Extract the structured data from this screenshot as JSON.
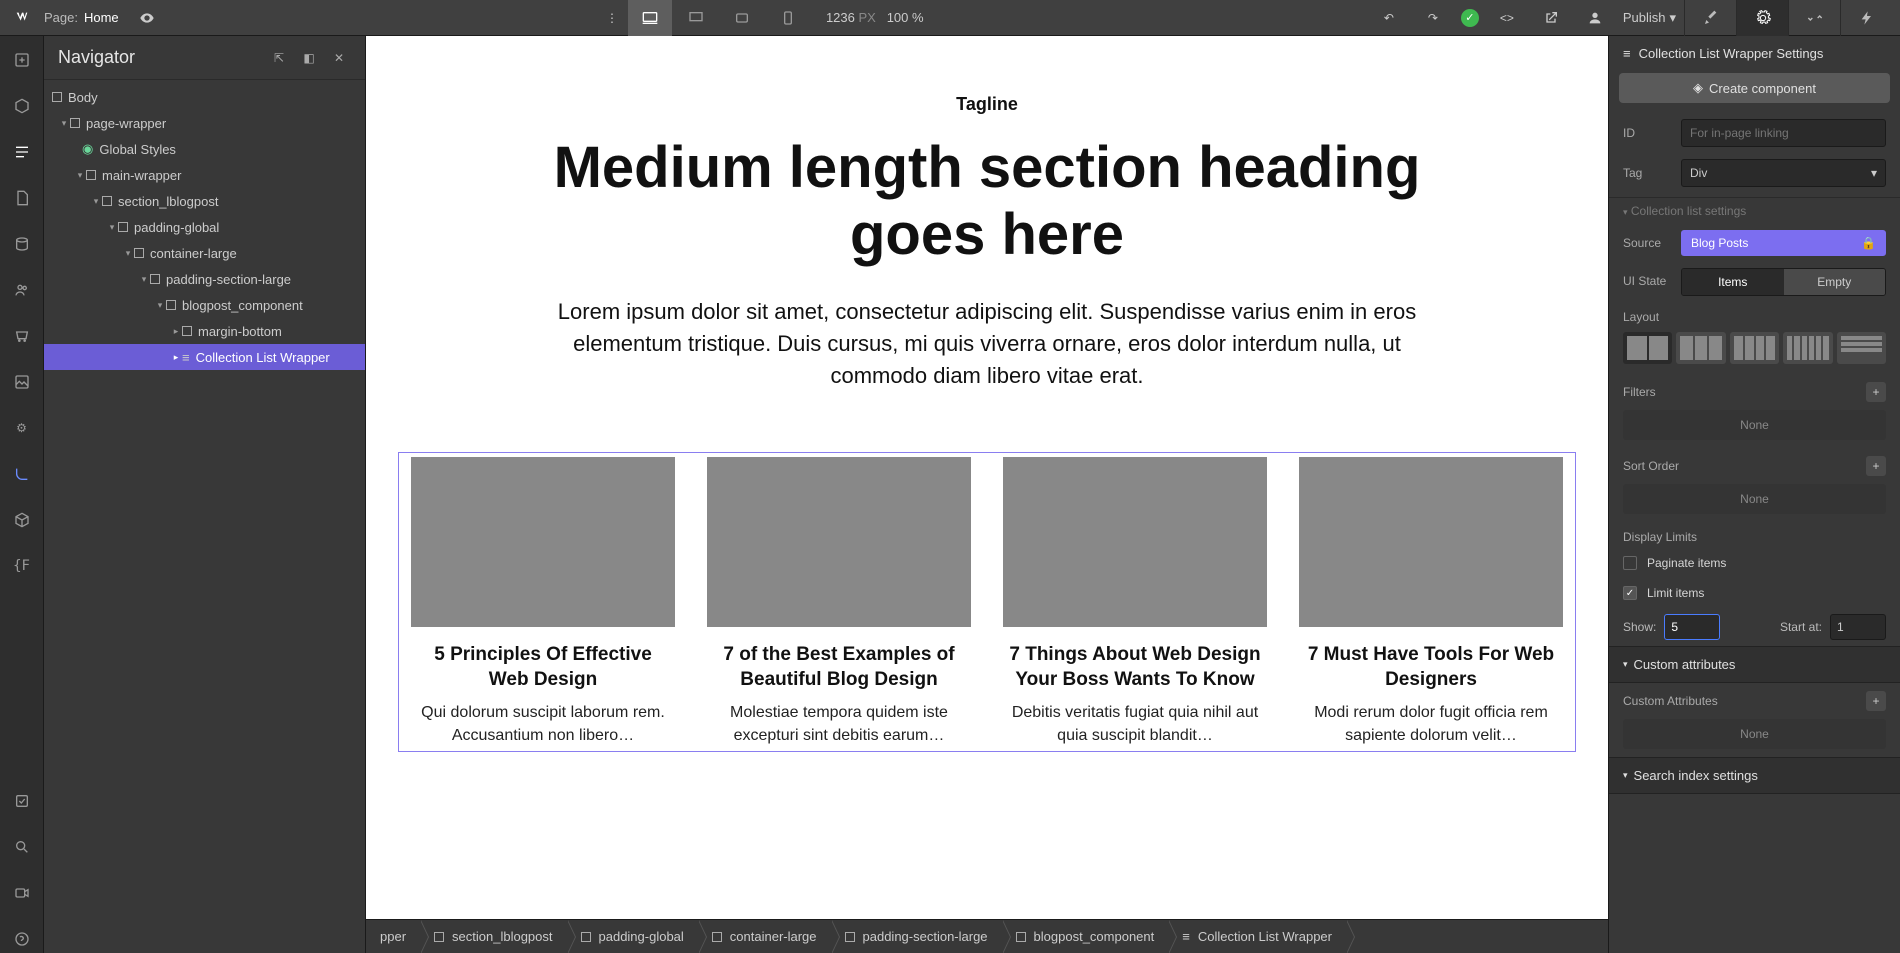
{
  "topbar": {
    "page_label": "Page:",
    "page_name": "Home",
    "canvas_width": "1236",
    "px_label": "PX",
    "zoom": "100 %",
    "publish": "Publish"
  },
  "navigator": {
    "title": "Navigator",
    "tree": {
      "body": "Body",
      "page_wrapper": "page-wrapper",
      "global_styles": "Global Styles",
      "main_wrapper": "main-wrapper",
      "section": "section_lblogpost",
      "padding_global": "padding-global",
      "container": "container-large",
      "padding_section": "padding-section-large",
      "component": "blogpost_component",
      "margin_bottom": "margin-bottom",
      "collection": "Collection List Wrapper"
    }
  },
  "content": {
    "tagline": "Tagline",
    "heading": "Medium length section heading goes here",
    "lead": "Lorem ipsum dolor sit amet, consectetur adipiscing elit. Suspendisse varius enim in eros elementum tristique. Duis cursus, mi quis viverra ornare, eros dolor interdum nulla, ut commodo diam libero vitae erat.",
    "posts": [
      {
        "title": "5 Principles Of Effective Web Design",
        "excerpt": "Qui dolorum suscipit laborum rem. Accusantium non libero…"
      },
      {
        "title": "7 of the Best Examples of Beautiful Blog Design",
        "excerpt": "Molestiae tempora quidem iste excepturi sint debitis earum…"
      },
      {
        "title": "7 Things About Web Design Your Boss Wants To Know",
        "excerpt": "Debitis veritatis fugiat quia nihil aut quia suscipit blandit…"
      },
      {
        "title": "7 Must Have Tools For Web Designers",
        "excerpt": "Modi rerum dolor fugit officia rem sapiente dolorum velit…"
      }
    ]
  },
  "breadcrumbs": {
    "b0": "pper",
    "b1": "section_lblogpost",
    "b2": "padding-global",
    "b3": "container-large",
    "b4": "padding-section-large",
    "b5": "blogpost_component",
    "b6": "Collection List Wrapper"
  },
  "panel": {
    "title": "Collection List Wrapper Settings",
    "create_component": "Create component",
    "id_label": "ID",
    "id_placeholder": "For in-page linking",
    "tag_label": "Tag",
    "tag_value": "Div",
    "collection_settings": "Collection list settings",
    "source_label": "Source",
    "source_value": "Blog Posts",
    "uistate_label": "UI State",
    "uistate_items": "Items",
    "uistate_empty": "Empty",
    "layout_label": "Layout",
    "filters_label": "Filters",
    "none": "None",
    "sort_label": "Sort Order",
    "display_limits": "Display Limits",
    "paginate": "Paginate items",
    "limit_items": "Limit items",
    "show_label": "Show:",
    "show_value": "5",
    "start_label": "Start at:",
    "start_value": "1",
    "custom_attrs": "Custom attributes",
    "custom_attrs_label": "Custom Attributes",
    "search_index": "Search index settings"
  }
}
